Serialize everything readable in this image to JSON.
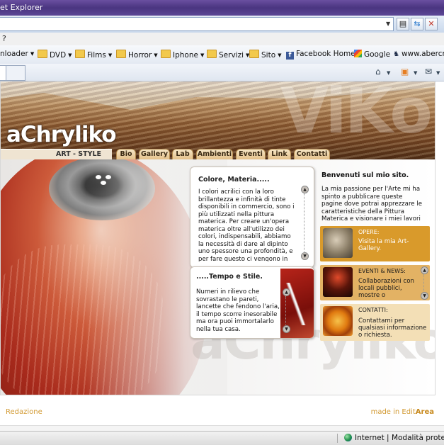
{
  "browser": {
    "title_fragment": "et Explorer",
    "menu_fragment": "?",
    "favorites": [
      {
        "label": "nloader",
        "folder": false,
        "caret": true
      },
      {
        "label": "DVD",
        "folder": true,
        "caret": true
      },
      {
        "label": "Films",
        "folder": true,
        "caret": true
      },
      {
        "label": "Horror",
        "folder": true,
        "caret": true
      },
      {
        "label": "Iphone",
        "folder": true,
        "caret": true
      },
      {
        "label": "Servizi",
        "folder": true,
        "caret": true
      },
      {
        "label": "Sito",
        "folder": true,
        "caret": true
      },
      {
        "label": "Facebook Home",
        "icon": "facebook-icon"
      },
      {
        "label": "Google",
        "icon": "google-icon"
      },
      {
        "label": "www.abercro",
        "icon": "moose-icon"
      }
    ],
    "status": {
      "zone": "Internet",
      "separator": "|",
      "protected_mode": "Modalità protetta: a"
    }
  },
  "site": {
    "logo": "aChryliko",
    "ghost_header": "ViKo",
    "ghost_footer": "aChryliko",
    "tagline": "ART - STYLE",
    "nav": [
      "Bio",
      "Gallery",
      "Lab",
      "Ambienti",
      "Eventi",
      "Link",
      "Contatti"
    ],
    "colore": {
      "title": "Colore, Materia.....",
      "text": "I colori acrilici con la loro brillantezza e infinità di tinte disponibili in commercio, sono i più utilizzati nella pittura materica. Per creare un'opera materica oltre all'utilizzo dei colori, indispensabili, abbiamo la necessità di dare al dipinto uno spessore una profondità, e per fare questo ci vengono in"
    },
    "tempo": {
      "title": ".....Tempo e Stile.",
      "text": "Numeri in rilievo che sovrastano le pareti, lancette che fendono l'aria, il tempo scorre inesorabile ma ora puoi immortalarlo nella tua casa."
    },
    "welcome": {
      "title": "Benvenuti sul mio sito.",
      "text": "La mia passione per l'Arte mi ha spinto a pubblicare queste pagine dove potrai apprezzare le caratteristiche della Pittura Materica e visionare i miei lavori"
    },
    "boxes": [
      {
        "heading": "OPERE:",
        "text": "Visita la mia Art-Gallery.",
        "bg": "#d99a2b",
        "fg": "#ffffff"
      },
      {
        "heading": "EVENTI & NEWS:",
        "text": "Collaborazioni con locali pubblici, mostre o",
        "bg": "#e3b264",
        "fg": "#1a1a1a"
      },
      {
        "heading": "CONTATTI:",
        "text": "Contattami per qualsiasi informazione o richiesta.",
        "bg": "#f3dfb6",
        "fg": "#1a1a1a"
      }
    ],
    "footer": {
      "left": "Redazione",
      "right_prefix": "made in Edit",
      "right_bold": "Area"
    }
  },
  "colors": {
    "accent": "#d99a2b",
    "nav_tab": "#e4c08a",
    "titlebar": "#4a3580"
  }
}
